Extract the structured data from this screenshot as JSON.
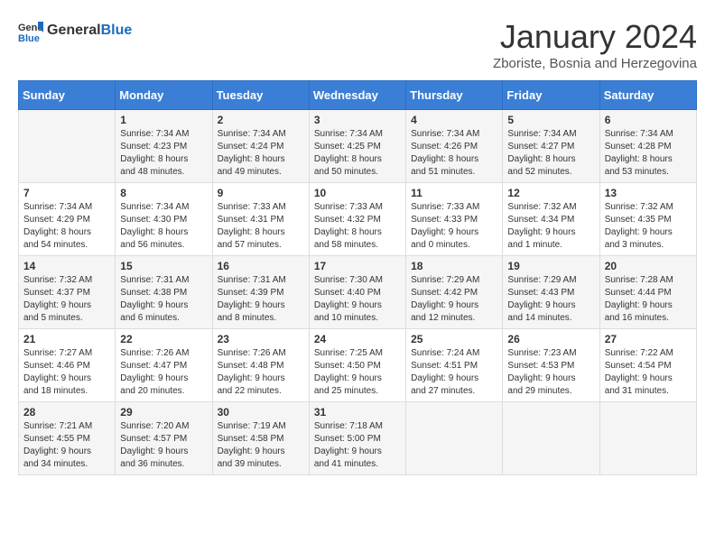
{
  "header": {
    "logo_general": "General",
    "logo_blue": "Blue",
    "month_year": "January 2024",
    "location": "Zboriste, Bosnia and Herzegovina"
  },
  "weekdays": [
    "Sunday",
    "Monday",
    "Tuesday",
    "Wednesday",
    "Thursday",
    "Friday",
    "Saturday"
  ],
  "weeks": [
    [
      {
        "day": "",
        "info": ""
      },
      {
        "day": "1",
        "info": "Sunrise: 7:34 AM\nSunset: 4:23 PM\nDaylight: 8 hours\nand 48 minutes."
      },
      {
        "day": "2",
        "info": "Sunrise: 7:34 AM\nSunset: 4:24 PM\nDaylight: 8 hours\nand 49 minutes."
      },
      {
        "day": "3",
        "info": "Sunrise: 7:34 AM\nSunset: 4:25 PM\nDaylight: 8 hours\nand 50 minutes."
      },
      {
        "day": "4",
        "info": "Sunrise: 7:34 AM\nSunset: 4:26 PM\nDaylight: 8 hours\nand 51 minutes."
      },
      {
        "day": "5",
        "info": "Sunrise: 7:34 AM\nSunset: 4:27 PM\nDaylight: 8 hours\nand 52 minutes."
      },
      {
        "day": "6",
        "info": "Sunrise: 7:34 AM\nSunset: 4:28 PM\nDaylight: 8 hours\nand 53 minutes."
      }
    ],
    [
      {
        "day": "7",
        "info": "Sunrise: 7:34 AM\nSunset: 4:29 PM\nDaylight: 8 hours\nand 54 minutes."
      },
      {
        "day": "8",
        "info": "Sunrise: 7:34 AM\nSunset: 4:30 PM\nDaylight: 8 hours\nand 56 minutes."
      },
      {
        "day": "9",
        "info": "Sunrise: 7:33 AM\nSunset: 4:31 PM\nDaylight: 8 hours\nand 57 minutes."
      },
      {
        "day": "10",
        "info": "Sunrise: 7:33 AM\nSunset: 4:32 PM\nDaylight: 8 hours\nand 58 minutes."
      },
      {
        "day": "11",
        "info": "Sunrise: 7:33 AM\nSunset: 4:33 PM\nDaylight: 9 hours\nand 0 minutes."
      },
      {
        "day": "12",
        "info": "Sunrise: 7:32 AM\nSunset: 4:34 PM\nDaylight: 9 hours\nand 1 minute."
      },
      {
        "day": "13",
        "info": "Sunrise: 7:32 AM\nSunset: 4:35 PM\nDaylight: 9 hours\nand 3 minutes."
      }
    ],
    [
      {
        "day": "14",
        "info": "Sunrise: 7:32 AM\nSunset: 4:37 PM\nDaylight: 9 hours\nand 5 minutes."
      },
      {
        "day": "15",
        "info": "Sunrise: 7:31 AM\nSunset: 4:38 PM\nDaylight: 9 hours\nand 6 minutes."
      },
      {
        "day": "16",
        "info": "Sunrise: 7:31 AM\nSunset: 4:39 PM\nDaylight: 9 hours\nand 8 minutes."
      },
      {
        "day": "17",
        "info": "Sunrise: 7:30 AM\nSunset: 4:40 PM\nDaylight: 9 hours\nand 10 minutes."
      },
      {
        "day": "18",
        "info": "Sunrise: 7:29 AM\nSunset: 4:42 PM\nDaylight: 9 hours\nand 12 minutes."
      },
      {
        "day": "19",
        "info": "Sunrise: 7:29 AM\nSunset: 4:43 PM\nDaylight: 9 hours\nand 14 minutes."
      },
      {
        "day": "20",
        "info": "Sunrise: 7:28 AM\nSunset: 4:44 PM\nDaylight: 9 hours\nand 16 minutes."
      }
    ],
    [
      {
        "day": "21",
        "info": "Sunrise: 7:27 AM\nSunset: 4:46 PM\nDaylight: 9 hours\nand 18 minutes."
      },
      {
        "day": "22",
        "info": "Sunrise: 7:26 AM\nSunset: 4:47 PM\nDaylight: 9 hours\nand 20 minutes."
      },
      {
        "day": "23",
        "info": "Sunrise: 7:26 AM\nSunset: 4:48 PM\nDaylight: 9 hours\nand 22 minutes."
      },
      {
        "day": "24",
        "info": "Sunrise: 7:25 AM\nSunset: 4:50 PM\nDaylight: 9 hours\nand 25 minutes."
      },
      {
        "day": "25",
        "info": "Sunrise: 7:24 AM\nSunset: 4:51 PM\nDaylight: 9 hours\nand 27 minutes."
      },
      {
        "day": "26",
        "info": "Sunrise: 7:23 AM\nSunset: 4:53 PM\nDaylight: 9 hours\nand 29 minutes."
      },
      {
        "day": "27",
        "info": "Sunrise: 7:22 AM\nSunset: 4:54 PM\nDaylight: 9 hours\nand 31 minutes."
      }
    ],
    [
      {
        "day": "28",
        "info": "Sunrise: 7:21 AM\nSunset: 4:55 PM\nDaylight: 9 hours\nand 34 minutes."
      },
      {
        "day": "29",
        "info": "Sunrise: 7:20 AM\nSunset: 4:57 PM\nDaylight: 9 hours\nand 36 minutes."
      },
      {
        "day": "30",
        "info": "Sunrise: 7:19 AM\nSunset: 4:58 PM\nDaylight: 9 hours\nand 39 minutes."
      },
      {
        "day": "31",
        "info": "Sunrise: 7:18 AM\nSunset: 5:00 PM\nDaylight: 9 hours\nand 41 minutes."
      },
      {
        "day": "",
        "info": ""
      },
      {
        "day": "",
        "info": ""
      },
      {
        "day": "",
        "info": ""
      }
    ]
  ]
}
